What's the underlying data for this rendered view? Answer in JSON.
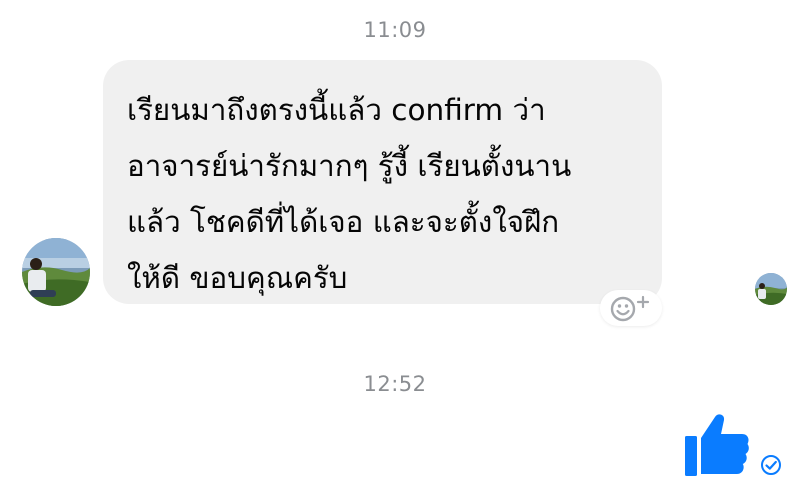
{
  "conversation": {
    "timestamps": [
      "11:09",
      "12:52"
    ],
    "incoming_message": {
      "text": "เรียนมาถึงตรงนี้แล้ว confirm ว่า\nอาจารย์น่ารักมากๆ รู้งี้ เรียนตั้งนาน\nแล้ว โชคดีที่ได้เจอ และจะตั้งใจฝึก\nให้ดี ขอบคุณครับ"
    },
    "icons": {
      "reaction": "add-reaction-icon",
      "like": "thumbs-up-icon",
      "status": "sent-check-icon"
    },
    "colors": {
      "brand_blue": "#0a7cff",
      "bubble_bg": "#f0f0f0",
      "timestamp": "#8a8d91"
    }
  }
}
